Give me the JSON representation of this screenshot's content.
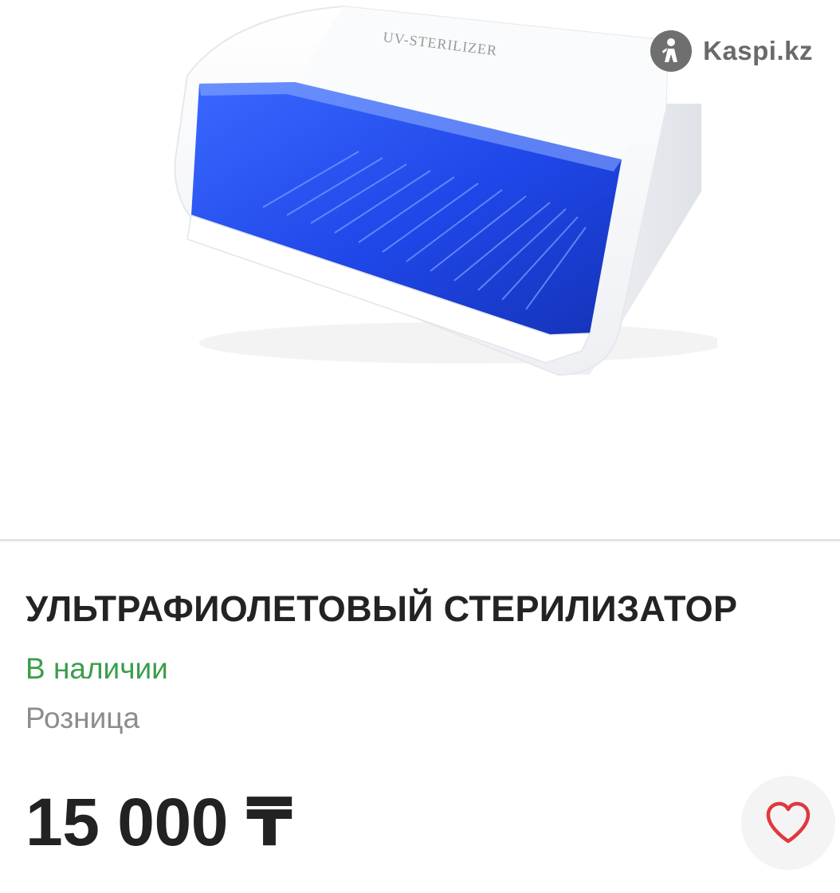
{
  "product": {
    "image_caption": "UV-STERILIZER",
    "title": "УЛЬТРАФИОЛЕТОВЫЙ СТЕРИЛИЗАТОР",
    "availability": "В наличии",
    "sale_type": "Розница",
    "price": "15 000 ₸"
  },
  "watermark": {
    "text": "Kaspi.kz",
    "icon": "kaspi-logo-icon"
  },
  "favorite": {
    "icon": "heart-outline-icon"
  },
  "colors": {
    "availability": "#3b9d4a",
    "heart": "#e0383e",
    "uv_blue": "#1f46e8"
  }
}
